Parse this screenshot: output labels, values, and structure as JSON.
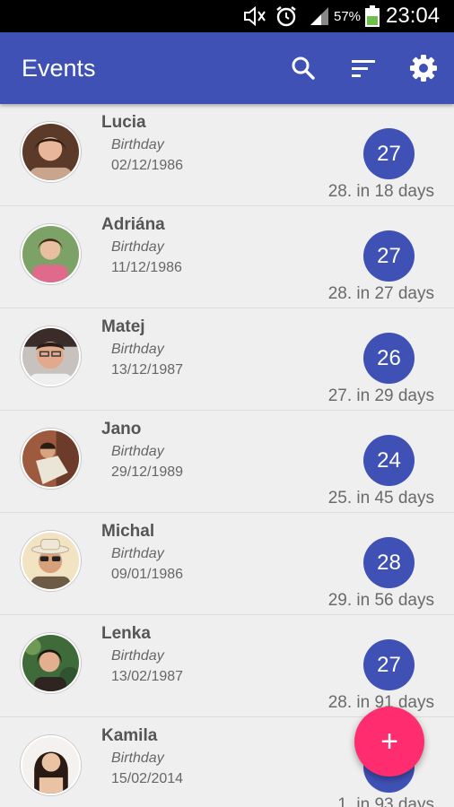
{
  "status_bar": {
    "icons": [
      "mute-icon",
      "alarm-icon",
      "signal-icon",
      "battery-icon"
    ],
    "battery_percent": "57%",
    "time": "23:04"
  },
  "app_bar": {
    "title": "Events",
    "actions": [
      "search-icon",
      "sort-icon",
      "settings-icon"
    ]
  },
  "events": [
    {
      "name": "Lucia",
      "type": "Birthday",
      "date": "02/12/1986",
      "age": "27",
      "countdown": "28. in 18 days"
    },
    {
      "name": "Adriána",
      "type": "Birthday",
      "date": "11/12/1986",
      "age": "27",
      "countdown": "28. in 27 days"
    },
    {
      "name": "Matej",
      "type": "Birthday",
      "date": "13/12/1987",
      "age": "26",
      "countdown": "27. in 29 days"
    },
    {
      "name": "Jano",
      "type": "Birthday",
      "date": "29/12/1989",
      "age": "24",
      "countdown": "25. in 45 days"
    },
    {
      "name": "Michal",
      "type": "Birthday",
      "date": "09/01/1986",
      "age": "28",
      "countdown": "29. in 56 days"
    },
    {
      "name": "Lenka",
      "type": "Birthday",
      "date": "13/02/1987",
      "age": "27",
      "countdown": "28. in 91 days"
    },
    {
      "name": "Kamila",
      "type": "Birthday",
      "date": "15/02/2014",
      "age": "",
      "countdown": "1. in 93 days"
    }
  ],
  "fab": {
    "icon": "plus-icon",
    "label": "+"
  },
  "colors": {
    "primary": "#3f51b5",
    "accent": "#ff2d6f",
    "background": "#efefef"
  }
}
